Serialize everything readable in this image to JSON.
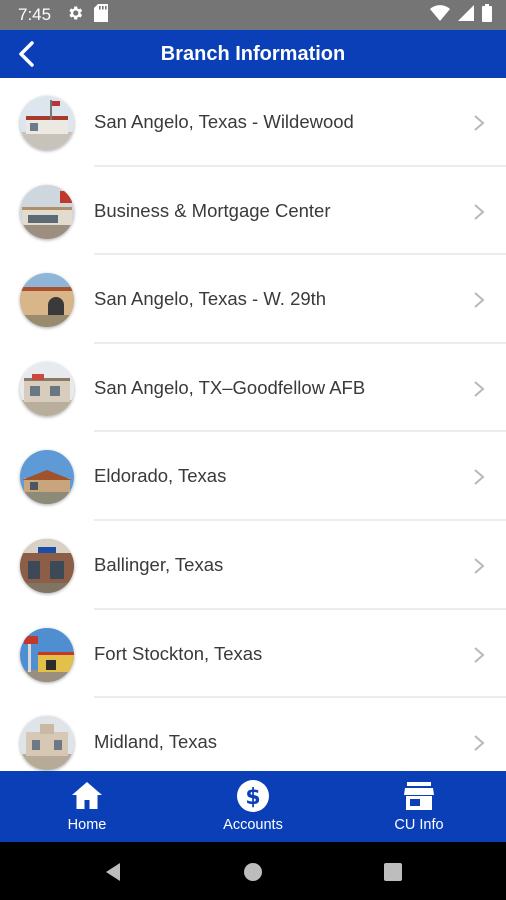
{
  "status_bar": {
    "time": "7:45"
  },
  "app_bar": {
    "title": "Branch Information"
  },
  "branches": [
    {
      "label": "San Angelo, Texas - Wildewood"
    },
    {
      "label": "Business & Mortgage Center"
    },
    {
      "label": "San Angelo, Texas - W. 29th"
    },
    {
      "label": "San Angelo, TX–Goodfellow AFB"
    },
    {
      "label": "Eldorado, Texas"
    },
    {
      "label": "Ballinger, Texas"
    },
    {
      "label": "Fort Stockton, Texas"
    },
    {
      "label": "Midland, Texas"
    }
  ],
  "bottom_nav": {
    "home": "Home",
    "accounts": "Accounts",
    "cu_info": "CU Info"
  },
  "colors": {
    "brand": "#0a3fb8",
    "status_bar": "#757575"
  }
}
